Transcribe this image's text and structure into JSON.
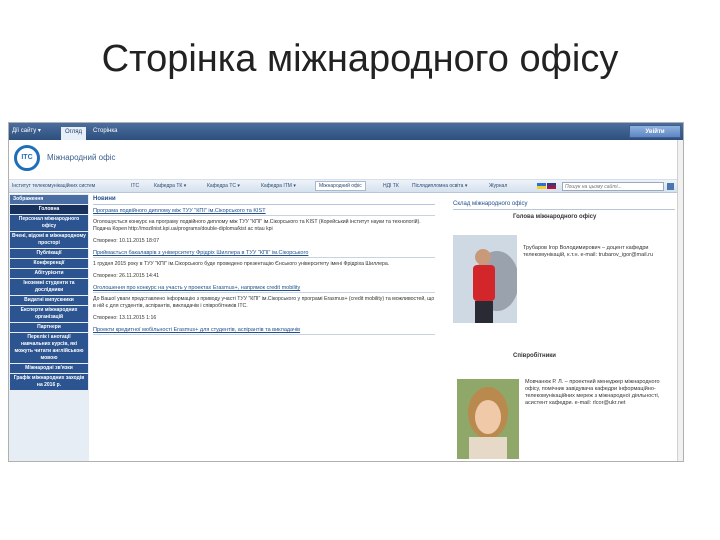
{
  "slide": {
    "title": "Сторінка міжнародного офісу"
  },
  "ribbon": {
    "actions_label": "Дії сайту ▾",
    "edit_tab": "Огляд",
    "page_tab": "Сторінка",
    "login_label": "Увійти"
  },
  "header": {
    "logo_text": "ITC",
    "site_name": "Міжнародний офіс"
  },
  "nav": {
    "items": [
      "Інститут телекомунікаційних систем",
      "ITC",
      "Кафедра ТК ▾",
      "Кафедра ТС ▾",
      "Кафедра ІТМ ▾",
      "Міжнародний офіс",
      "НДІ ТК",
      "Післядипломна освіта ▾",
      "Журнал"
    ],
    "active_index": 5,
    "search_placeholder": "Пошук на цьому сайті..."
  },
  "sidebar": {
    "items": [
      "Зображення",
      "Головна",
      "Персонал міжнародного офісу",
      "Вчені, відомі в міжнародному просторі",
      "Публікації",
      "Конференції",
      "Абітурієнти",
      "Іноземні студенти та дослідники",
      "Видатні випускники",
      "Експерти міжнародних організацій",
      "Партнери",
      "Перелік і анотації навчальних курсів, які можуть читати англійською мовою",
      "Міжнародні зв'язки",
      "Графік міжнародних заходів на 2016 р."
    ]
  },
  "news": {
    "heading": "Новини",
    "items": [
      {
        "link": "Програма подвійного диплому між ТУУ \"КПІ\" ім.Сікорського та KIST",
        "body": "Оголошується конкурс на програму подвійного диплому між ТУУ \"КПІ\" ім.Сікорського та KIST (Корейський інститут науки та технологій). Подача Корея http://mozilnist.kpi.ua/programs/double-diploma/kist ac ntau kpi",
        "date": "Створено: 10.11.2015 18:07"
      },
      {
        "link": "Приймається бакалаврів з університету Фрідріх Шиллера в ТУУ \"КПІ\" ім.Сікорського",
        "body": "1 грудня 2015 року в ТУУ \"КПІ\" ім.Сікорського буде проведено презентацію Єнського університету імені Фрідріха Шиллера.",
        "date": "Створено: 26.11.2015 14:41"
      },
      {
        "link": "Оголошення про конкурс на участь у проектах Erasmus+, напрямок credit mobility",
        "body": "До Вашої уваги представлено інформацію з приводу участі ТУУ \"КПІ\" ім.Сікорського у програмі Erasmus+ (credit mobility) та можливостей, що в ній є для студентів, аспірантів, викладачів і співробітників ITC.",
        "date": "Створено: 13.11.2015 1:16"
      },
      {
        "link": "Проекти кредитної мобільності Erasmus+ для студентів, аспірантів та викладачів",
        "body": "",
        "date": ""
      }
    ]
  },
  "office": {
    "heading": "Склад міжнародного офісу",
    "head_title": "Голова міжнародного офісу",
    "head_person": "Трубаров Ігор Володимирович – доцент кафедри телекомунікацій, к.т.н. e-mail: trubarov_igor@mail.ru",
    "coop_title": "Співробітники",
    "coop_person": "Мовчанюк Р. Л. – проектний менеджер міжнародного офісу, помічник завідувача кафедри інформаційно-телекомунікаційних мереж з міжнародної діяльності, асистент кафедри. e-mail: rlcor@ukr.net"
  }
}
